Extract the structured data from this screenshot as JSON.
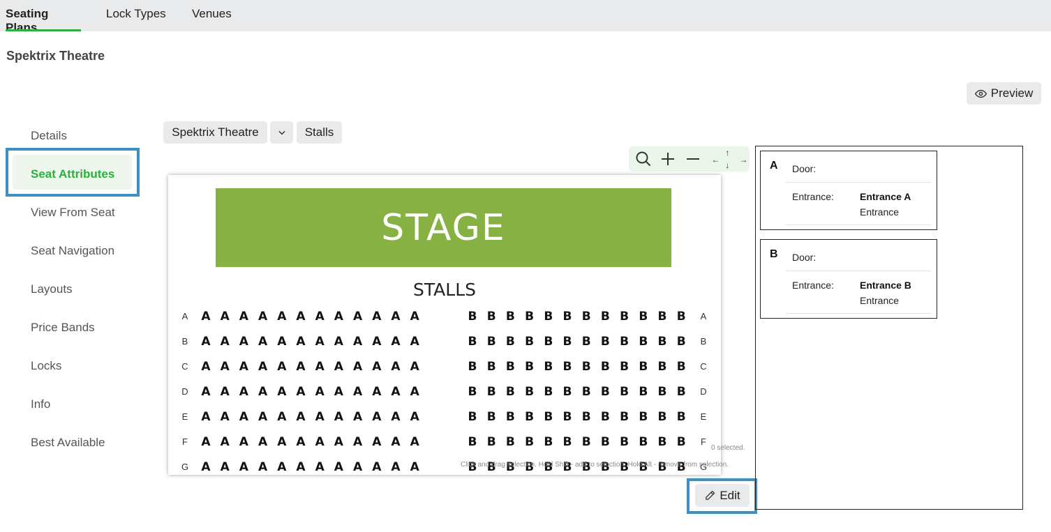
{
  "tabs": [
    {
      "label": "Seating Plans",
      "active": true
    },
    {
      "label": "Lock Types",
      "active": false
    },
    {
      "label": "Venues",
      "active": false
    }
  ],
  "venue_title": "Spektrix Theatre",
  "preview_label": "Preview",
  "nav": [
    {
      "label": "Details",
      "active": false
    },
    {
      "label": "Seat Attributes",
      "active": true
    },
    {
      "label": "View From Seat",
      "active": false
    },
    {
      "label": "Seat Navigation",
      "active": false
    },
    {
      "label": "Layouts",
      "active": false
    },
    {
      "label": "Price Bands",
      "active": false
    },
    {
      "label": "Locks",
      "active": false
    },
    {
      "label": "Info",
      "active": false
    },
    {
      "label": "Best Available",
      "active": false
    }
  ],
  "breadcrumb": {
    "venue": "Spektrix Theatre",
    "area": "Stalls"
  },
  "map": {
    "stage_label": "STAGE",
    "section_label": "STALLS",
    "rows": [
      "A",
      "B",
      "C",
      "D",
      "E",
      "F",
      "G"
    ],
    "left_block_letter": "A",
    "right_block_letter": "B",
    "left_block_count": 12,
    "right_block_count": 12
  },
  "selection": {
    "count_text": "0 selected.",
    "help_text": "Click and drag selection. Hold Shift - add to selection. Hold Alt - remove from selection."
  },
  "edit_label": "Edit",
  "attributes": [
    {
      "key": "A",
      "door_label": "Door:",
      "entrance_label": "Entrance:",
      "entrance_name": "Entrance A",
      "entrance_type": "Entrance"
    },
    {
      "key": "B",
      "door_label": "Door:",
      "entrance_label": "Entrance:",
      "entrance_name": "Entrance B",
      "entrance_type": "Entrance"
    }
  ],
  "colors": {
    "accent_green": "#2bb03b",
    "stage_green": "#87b243",
    "highlight_blue": "#3d8fc4",
    "toolbar_bg": "#e8eaeb"
  }
}
